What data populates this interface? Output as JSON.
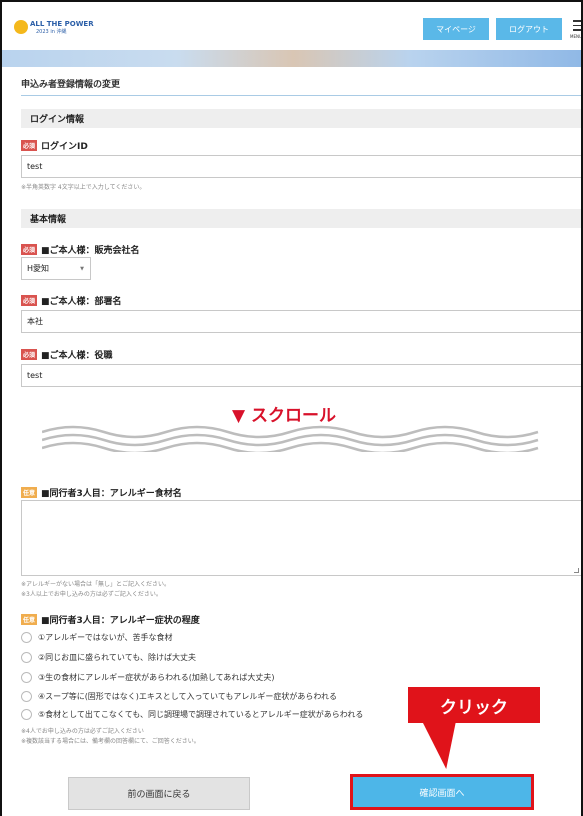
{
  "header": {
    "logo_line1": "ALL THE POWER",
    "logo_line2": "2023 in 沖縄",
    "mypage_label": "マイページ",
    "logout_label": "ログアウト",
    "menu_label": "MENU"
  },
  "page_title": "申込み者登録情報の変更",
  "sections": {
    "login": "ログイン情報",
    "basic": "基本情報"
  },
  "badges": {
    "required": "必須",
    "optional": "任意"
  },
  "fields": {
    "login_id": {
      "label": "ログインID",
      "value": "test",
      "note": "※半角英数字 4文字以上で入力してください。"
    },
    "company": {
      "label": "■ご本人様：販売会社名",
      "value": "H愛知"
    },
    "department": {
      "label": "■ご本人様：部署名",
      "value": "本社"
    },
    "position": {
      "label": "■ご本人様：役職",
      "value": "test"
    },
    "allergy_food": {
      "label": "■同行者3人目：アレルギー食材名",
      "value": "",
      "note1": "※アレルギーがない場合は「無し」とご記入ください。",
      "note2": "※3人以上でお申し込みの方は必ずご記入ください。"
    },
    "allergy_level": {
      "label": "■同行者3人目：アレルギー症状の程度",
      "options": [
        "①アレルギーではないが、苦手な食材",
        "②同じお皿に盛られていても、除けば大丈夫",
        "③生の食材にアレルギー症状があらわれる(加熱してあれば大丈夫)",
        "④スープ等に(固形ではなく)エキスとして入っていてもアレルギー症状があらわれる",
        "⑤食材として出てこなくても、同じ調理場で調理されているとアレルギー症状があらわれる"
      ],
      "note1": "※4人でお申し込みの方は必ずご記入ください",
      "note2": "※複数該当する場合には、備考欄の回答欄にて、ご回答ください。"
    }
  },
  "overlay": {
    "scroll_label": "▼ スクロール",
    "click_label": "クリック"
  },
  "buttons": {
    "back": "前の画面に戻る",
    "confirm": "確認画面へ"
  },
  "colors": {
    "accent": "#4db6e8",
    "highlight": "#e0131a",
    "required": "#d9534f",
    "optional": "#f0ad4e"
  }
}
